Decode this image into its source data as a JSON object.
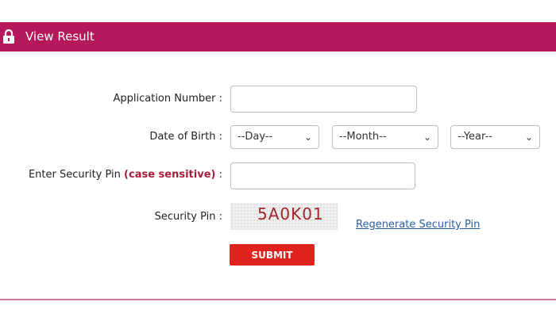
{
  "header": {
    "title": "View Result",
    "icon": "lock-icon"
  },
  "form": {
    "application_number": {
      "label": "Application Number :",
      "value": ""
    },
    "dob": {
      "label": "Date of Birth :",
      "day": "--Day--",
      "month": "--Month--",
      "year": "--Year--"
    },
    "security_pin_input": {
      "label_prefix": "Enter Security Pin",
      "label_emphasis": "(case sensitive)",
      "label_suffix": ":",
      "value": ""
    },
    "security_pin": {
      "label": "Security Pin :",
      "captcha": "5A0K01",
      "regenerate_label": "Regenerate Security Pin"
    },
    "submit_label": "SUBMIT"
  },
  "colors": {
    "brand": "#b5195b",
    "submit": "#e0231c",
    "link": "#2a5fa8",
    "emphasis": "#a51e3a"
  }
}
